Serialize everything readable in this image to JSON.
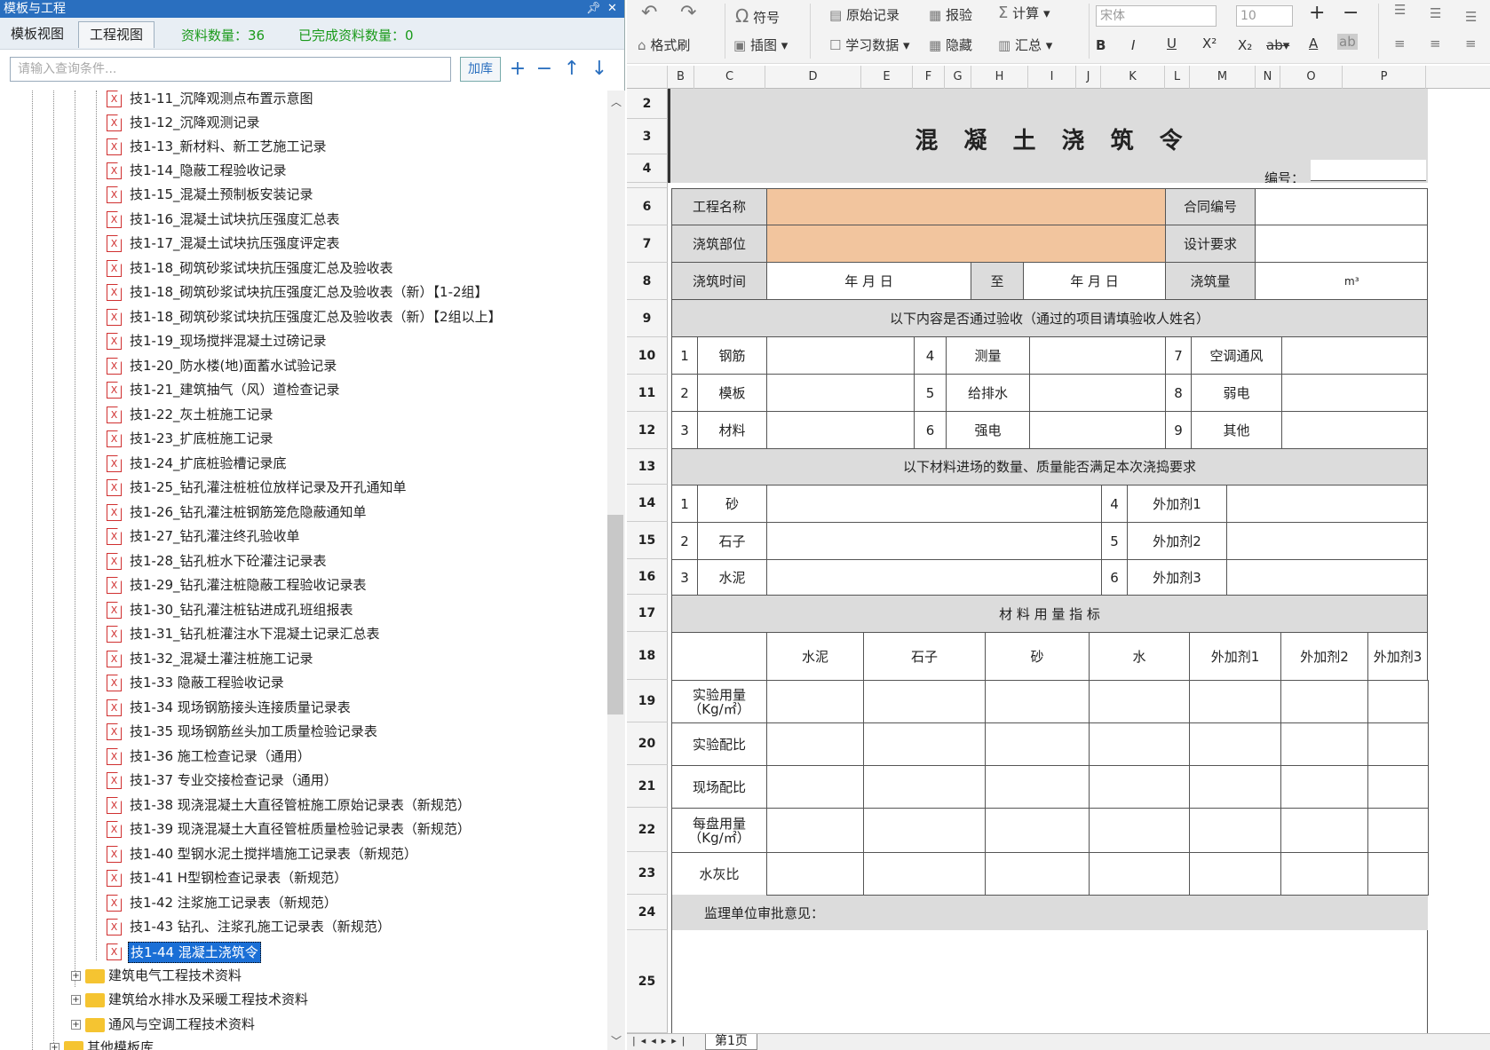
{
  "panel": {
    "title": "模板与工程",
    "pin_icon": "pin-icon",
    "close_icon": "close-icon",
    "tabs": [
      "模板视图",
      "工程视图"
    ],
    "stats": {
      "count_label": "资料数量：36",
      "done_label": "已完成资料数量：0"
    },
    "search": {
      "placeholder": "请输入查询条件..."
    },
    "add_lib": "加库"
  },
  "tree": {
    "items": [
      "技1-11_沉降观测点布置示意图",
      "技1-12_沉降观测记录",
      "技1-13_新材料、新工艺施工记录",
      "技1-14_隐蔽工程验收记录",
      "技1-15_混凝土预制板安装记录",
      "技1-16_混凝土试块抗压强度汇总表",
      "技1-17_混凝土试块抗压强度评定表",
      "技1-18_砌筑砂浆试块抗压强度汇总及验收表",
      "技1-18_砌筑砂浆试块抗压强度汇总及验收表（新）【1-2组】",
      "技1-18_砌筑砂浆试块抗压强度汇总及验收表（新）【2组以上】",
      "技1-19_现场搅拌混凝土过磅记录",
      "技1-20_防水楼(地)面蓄水试验记录",
      "技1-21_建筑抽气（风）道检查记录",
      "技1-22_灰土桩施工记录",
      "技1-23_扩底桩施工记录",
      "技1-24_扩底桩验槽记录底",
      "技1-25_钻孔灌注桩桩位放样记录及开孔通知单",
      "技1-26_钻孔灌注桩钢筋笼危隐蔽通知单",
      "技1-27_钻孔灌注终孔验收单",
      "技1-28_钻孔桩水下砼灌注记录表",
      "技1-29_钻孔灌注桩隐蔽工程验收记录表",
      "技1-30_钻孔灌注桩钻进成孔班组报表",
      "技1-31_钻孔桩灌注水下混凝土记录汇总表",
      "技1-32_混凝土灌注桩施工记录",
      "技1-33 隐蔽工程验收记录",
      "技1-34 现场钢筋接头连接质量记录表",
      "技1-35 现场钢筋丝头加工质量检验记录表",
      "技1-36 施工检查记录（通用）",
      "技1-37 专业交接检查记录（通用）",
      "技1-38 现浇混凝土大直径管桩施工原始记录表（新规范）",
      "技1-39 现浇混凝土大直径管桩质量检验记录表（新规范）",
      "技1-40 型钢水泥土搅拌墙施工记录表（新规范）",
      "技1-41 H型钢检查记录表（新规范）",
      "技1-42 注浆施工记录表（新规范）",
      "技1-43 钻孔、注浆孔施工记录表（新规范）",
      "技1-44 混凝土浇筑令"
    ],
    "folders": [
      "建筑电气工程技术资料",
      "建筑给水排水及采暖工程技术资料",
      "通风与空调工程技术资料",
      "其他模板库"
    ]
  },
  "toolbar": {
    "symbol": "符号",
    "raw_record": "原始记录",
    "report": "报验",
    "calc": "计算",
    "format_brush": "格式刷",
    "insert_image": "插图",
    "study_data": "学习数据",
    "hide": "隐藏",
    "summary": "汇总",
    "font": "宋体",
    "size": "10"
  },
  "sheet": {
    "cols": [
      "B",
      "C",
      "D",
      "E",
      "F",
      "G",
      "H",
      "I",
      "J",
      "K",
      "L",
      "M",
      "N",
      "O",
      "P"
    ],
    "rows": [
      "2",
      "3",
      "4",
      "6",
      "7",
      "8",
      "9",
      "10",
      "11",
      "12",
      "13",
      "14",
      "15",
      "16",
      "17",
      "18",
      "19",
      "20",
      "21",
      "22",
      "23",
      "24",
      "25"
    ],
    "title": "混 凝 土 浇 筑 令",
    "serial_label": "编号：",
    "project_name": "工程名称",
    "contract_no": "合同编号",
    "pour_part": "浇筑部位",
    "design_req": "设计要求",
    "pour_time": "浇筑时间",
    "date1": "年  月  日",
    "to": "至",
    "date2": "年  月  日",
    "pour_volume": "浇筑量",
    "unit": "m³",
    "inspect_header": "以下内容是否通过验收（通过的项目请填验收人姓名）",
    "inspect": [
      {
        "n": "1",
        "l": "钢筋"
      },
      {
        "n": "4",
        "l": "测量"
      },
      {
        "n": "7",
        "l": "空调通风"
      },
      {
        "n": "2",
        "l": "模板"
      },
      {
        "n": "5",
        "l": "给排水"
      },
      {
        "n": "8",
        "l": "弱电"
      },
      {
        "n": "3",
        "l": "材料"
      },
      {
        "n": "6",
        "l": "强电"
      },
      {
        "n": "9",
        "l": "其他"
      }
    ],
    "material_header": "以下材料进场的数量、质量能否满足本次浇捣要求",
    "materials": [
      {
        "n": "1",
        "l": "砂"
      },
      {
        "n": "4",
        "l": "外加剂1"
      },
      {
        "n": "2",
        "l": "石子"
      },
      {
        "n": "5",
        "l": "外加剂2"
      },
      {
        "n": "3",
        "l": "水泥"
      },
      {
        "n": "6",
        "l": "外加剂3"
      }
    ],
    "usage_header": "材     料     用     量     指     标",
    "usage_cols": [
      "水泥",
      "石子",
      "砂",
      "水",
      "外加剂1",
      "外加剂2",
      "外加剂3"
    ],
    "usage_rows": [
      "实验用量\n（Kg/㎡）",
      "实验配比",
      "现场配比",
      "每盘用量\n（Kg/㎡）",
      "水灰比"
    ],
    "supervisor": "监理单位审批意见：",
    "sheet_tab": "第1页"
  }
}
